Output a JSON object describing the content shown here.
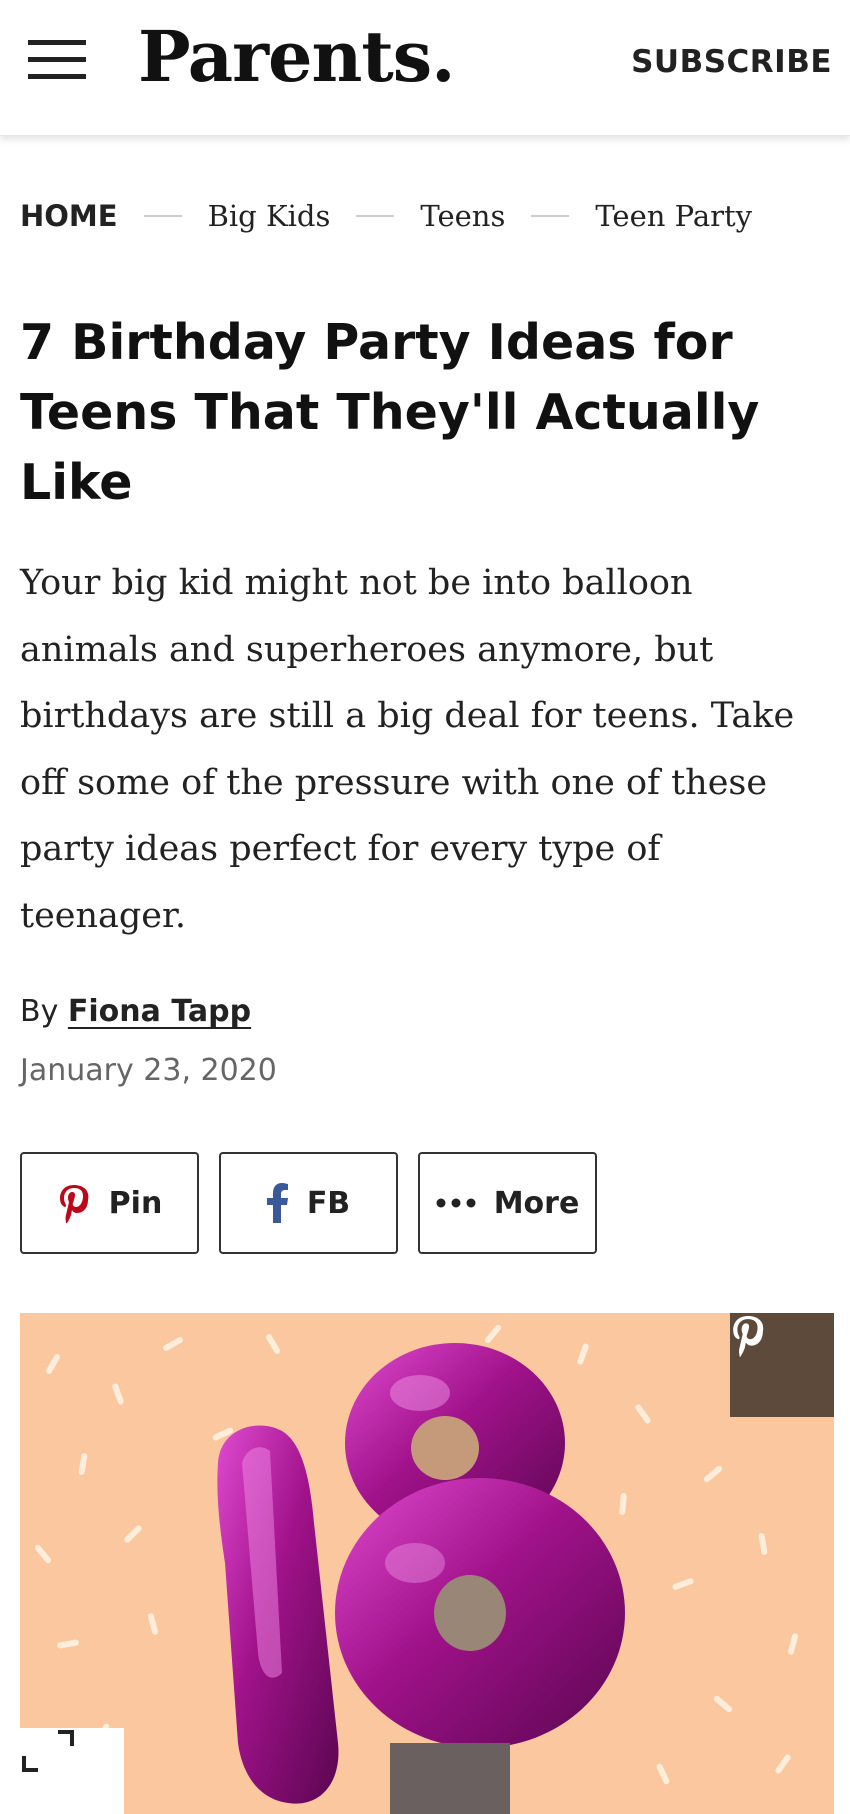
{
  "header": {
    "logo": "Parents.",
    "subscribe_label": "SUBSCRIBE"
  },
  "breadcrumb": {
    "home": "HOME",
    "items": [
      "Big Kids",
      "Teens",
      "Teen Party"
    ]
  },
  "article": {
    "title": "7 Birthday Party Ideas for Teens That They'll Actually Like",
    "dek": "Your big kid might not be into balloon animals and superheroes anymore, but birthdays are still a big deal for teens. Take off some of the pressure with one of these party ideas perfect for every type of teenager.",
    "byline_prefix": "By",
    "author": "Fiona Tapp",
    "date": "January 23, 2020"
  },
  "share": {
    "pin_label": "Pin",
    "fb_label": "FB",
    "more_label": "More"
  },
  "colors": {
    "hero_background": "#fbc79e",
    "balloon_magenta": "#a0128a",
    "pinterest_red": "#bd081c",
    "facebook_blue": "#3b5998",
    "pin_badge": "#5e4a3a"
  },
  "icons": {
    "menu": "hamburger-icon",
    "pin": "pinterest-icon",
    "fb": "facebook-icon",
    "more": "more-dots-icon",
    "image_pin": "pinterest-icon",
    "expand": "expand-icon"
  }
}
